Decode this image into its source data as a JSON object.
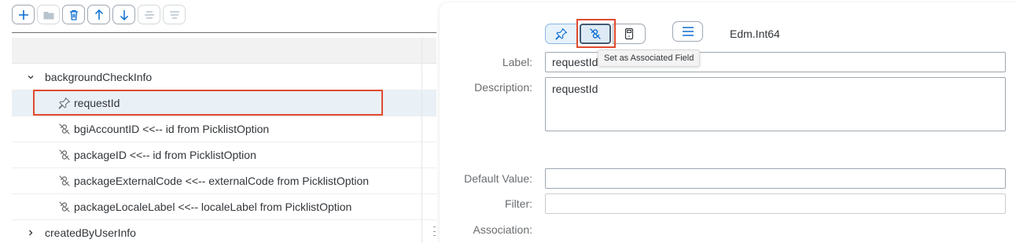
{
  "toolbar": {
    "buttons": [
      {
        "icon": "add-icon",
        "enabled": true
      },
      {
        "icon": "folder-icon",
        "enabled": false
      },
      {
        "icon": "delete-icon",
        "enabled": true
      },
      {
        "icon": "arrow-up-icon",
        "enabled": true
      },
      {
        "icon": "arrow-down-icon",
        "enabled": true
      },
      {
        "icon": "align-center-icon",
        "enabled": false
      },
      {
        "icon": "align-justify-icon",
        "enabled": false
      }
    ]
  },
  "tree": {
    "rows": [
      {
        "label": "backgroundCheckInfo",
        "type": "group",
        "expanded": true
      },
      {
        "label": "requestId",
        "type": "field",
        "icon": "pin-icon",
        "selected": true
      },
      {
        "label": "bgiAccountID <<-- id from PicklistOption",
        "type": "field",
        "icon": "unlink-icon"
      },
      {
        "label": "packageID <<-- id from PicklistOption",
        "type": "field",
        "icon": "unlink-icon"
      },
      {
        "label": "packageExternalCode <<-- externalCode from PicklistOption",
        "type": "field",
        "icon": "unlink-icon"
      },
      {
        "label": "packageLocaleLabel <<-- localeLabel from PicklistOption",
        "type": "field",
        "icon": "unlink-icon"
      },
      {
        "label": "createdByUserInfo",
        "type": "group",
        "expanded": false
      }
    ]
  },
  "details": {
    "segmented": [
      {
        "icon": "pin-icon",
        "pressed": true
      },
      {
        "icon": "unlink-icon",
        "pressed": true
      },
      {
        "icon": "calculator-icon",
        "pressed": false
      }
    ],
    "menu_icon": "menu-icon",
    "type": "Edm.Int64",
    "tooltip": "Set as Associated Field",
    "label_caption": "Label:",
    "label_value": "requestId",
    "description_caption": "Description:",
    "description_value": "requestId",
    "default_caption": "Default Value:",
    "default_value": "",
    "filter_caption": "Filter:",
    "filter_value": "",
    "association_caption": "Association:"
  },
  "colors": {
    "accent": "#0a6ed1",
    "highlight": "#e04b2f",
    "selected_row": "#e9f0f6"
  }
}
